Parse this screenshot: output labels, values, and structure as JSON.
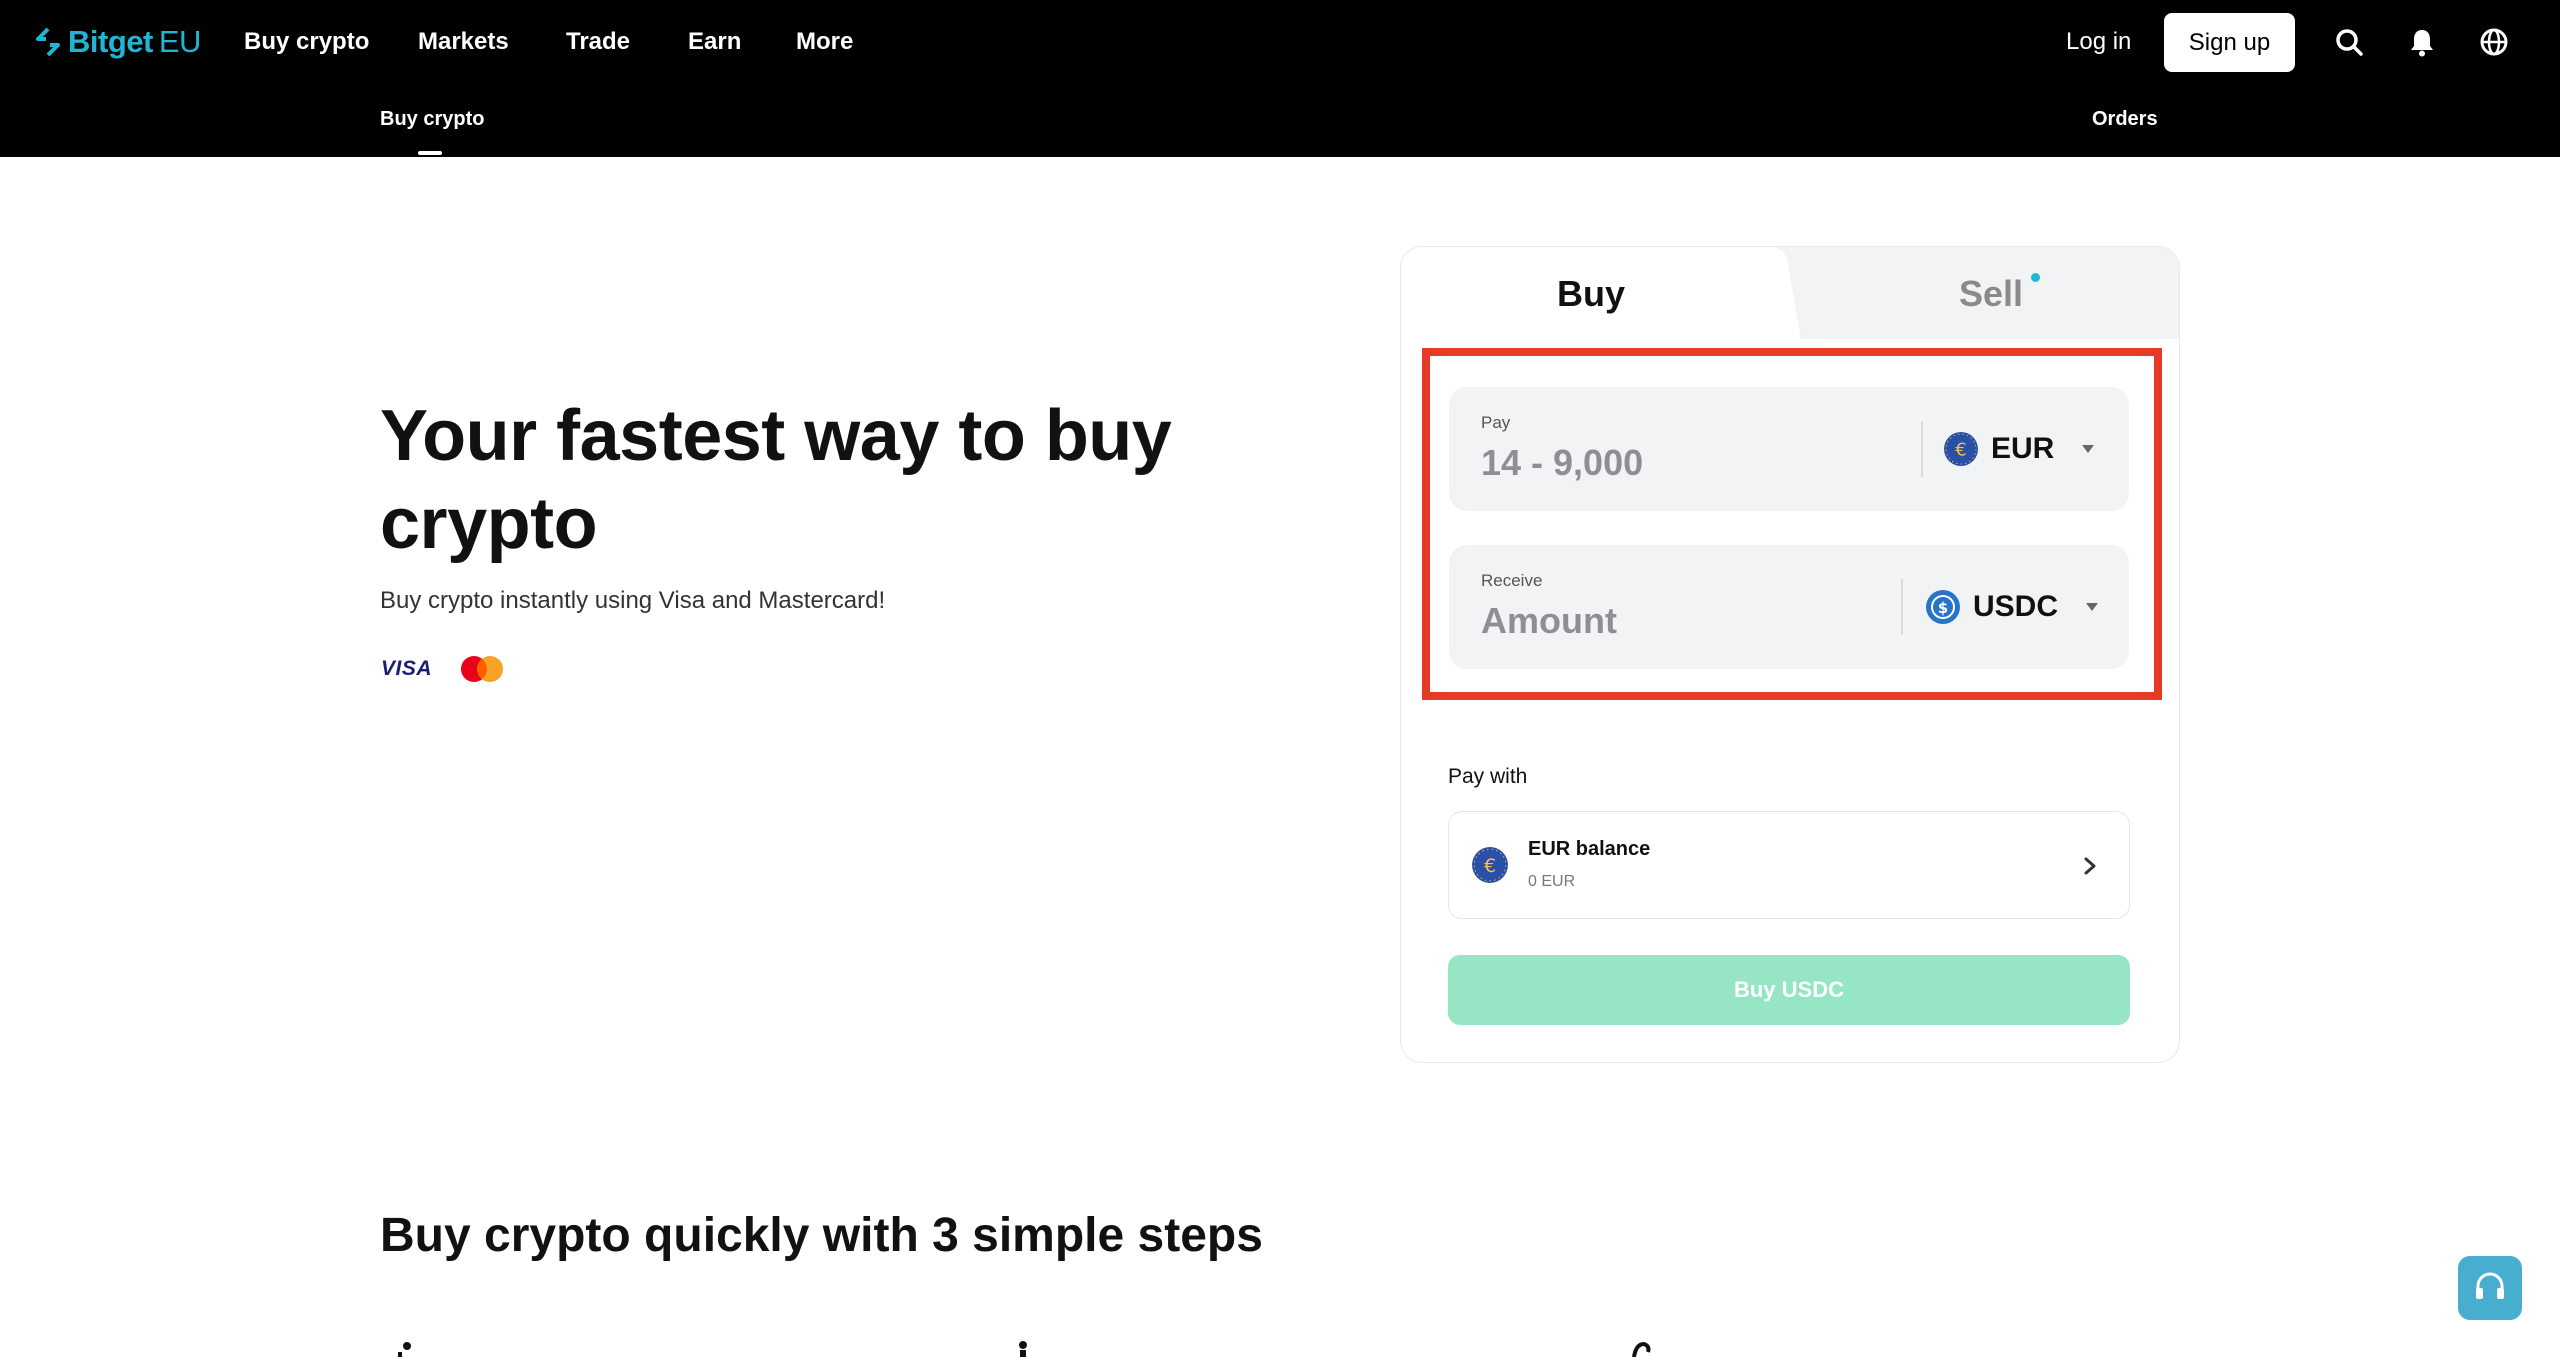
{
  "brand": {
    "name": "Bitget",
    "suffix": "EU",
    "color": "#1fb6d4"
  },
  "nav": {
    "items": [
      "Buy crypto",
      "Markets",
      "Trade",
      "Earn",
      "More"
    ],
    "login": "Log in",
    "signup": "Sign up",
    "icons": [
      "search-icon",
      "bell-icon",
      "globe-icon"
    ]
  },
  "subnav": {
    "active": "Buy crypto",
    "orders": "Orders"
  },
  "hero": {
    "title": "Your fastest way to buy crypto",
    "subtitle": "Buy crypto instantly using Visa and Mastercard!",
    "visa": "VISA"
  },
  "trade_card": {
    "tabs": {
      "buy": "Buy",
      "sell": "Sell"
    },
    "active_tab": "Buy",
    "pay": {
      "label": "Pay",
      "placeholder": "14 - 9,000",
      "currency": "EUR"
    },
    "receive": {
      "label": "Receive",
      "placeholder": "Amount",
      "currency": "USDC"
    },
    "pay_with": {
      "label": "Pay with",
      "method": "EUR balance",
      "balance": "0 EUR"
    },
    "buy_button": "Buy USDC",
    "buy_button_color": "#96e6c6",
    "highlight_color": "#e53a25"
  },
  "steps": {
    "title": "Buy crypto quickly with 3 simple steps"
  }
}
